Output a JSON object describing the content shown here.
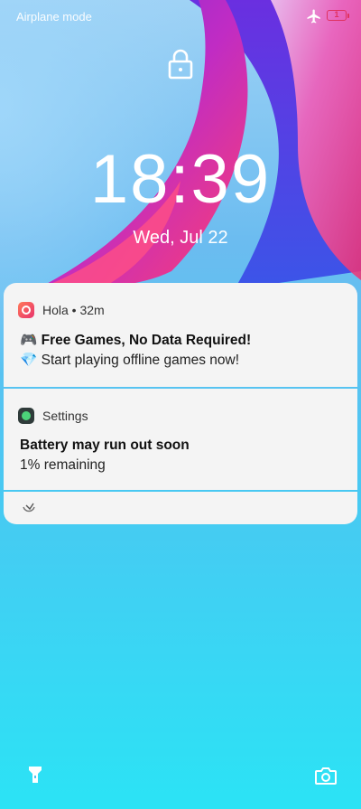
{
  "status_bar": {
    "mode_text": "Airplane mode",
    "battery_level": "1"
  },
  "lockscreen": {
    "time": "18:39",
    "date": "Wed, Jul 22"
  },
  "notifications": [
    {
      "app": "Hola",
      "age": "32m",
      "title": "🎮 Free Games, No Data Required!",
      "body": "💎 Start playing offline games now!"
    },
    {
      "app": "Settings",
      "title": "Battery may run out soon",
      "body": "1% remaining"
    }
  ],
  "bottom": {
    "left_icon": "flashlight-icon",
    "right_icon": "camera-icon"
  },
  "colors": {
    "battery": "#e0315f",
    "card": "#f4f4f4"
  }
}
